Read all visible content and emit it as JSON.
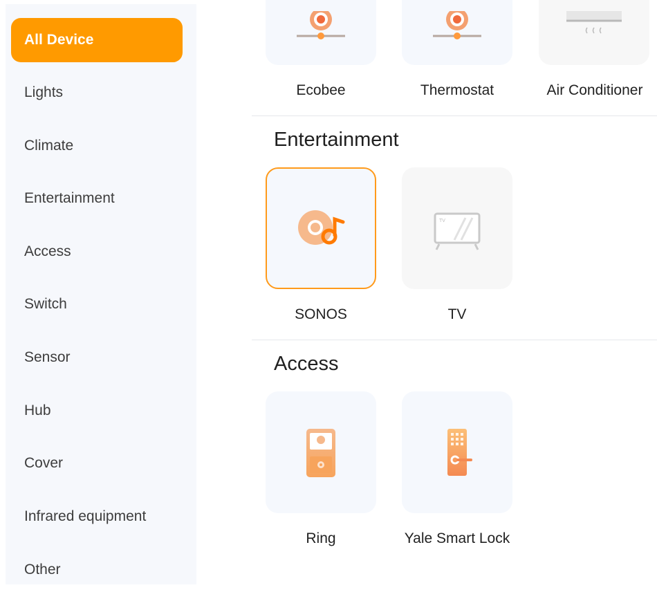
{
  "sidebar": {
    "items": [
      {
        "label": "All Device",
        "active": true
      },
      {
        "label": "Lights"
      },
      {
        "label": "Climate"
      },
      {
        "label": "Entertainment"
      },
      {
        "label": "Access"
      },
      {
        "label": "Switch"
      },
      {
        "label": "Sensor"
      },
      {
        "label": "Hub"
      },
      {
        "label": "Cover"
      },
      {
        "label": "Infrared equipment"
      },
      {
        "label": "Other"
      }
    ]
  },
  "climate": {
    "devices": [
      {
        "label": "Ecobee",
        "icon": "thermostat-icon"
      },
      {
        "label": "Thermostat",
        "icon": "thermostat-icon"
      },
      {
        "label": "Air Conditioner",
        "icon": "air-conditioner-icon"
      }
    ]
  },
  "entertainment": {
    "title": "Entertainment",
    "devices": [
      {
        "label": "SONOS",
        "icon": "speaker-music-icon",
        "selected": true
      },
      {
        "label": "TV",
        "icon": "tv-icon"
      }
    ]
  },
  "access": {
    "title": "Access",
    "devices": [
      {
        "label": "Ring",
        "icon": "doorbell-icon"
      },
      {
        "label": "Yale Smart Lock",
        "icon": "smart-lock-icon"
      }
    ]
  },
  "colors": {
    "accent": "#ff9a00",
    "sidebar_bg": "#f6f8fc",
    "card_bg": "#f5f8fd"
  }
}
